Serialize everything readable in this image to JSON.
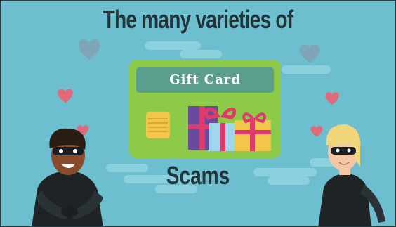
{
  "title": "The many varieties of",
  "card": {
    "label": "Gift Card"
  },
  "subtitle": "Scams",
  "colors": {
    "background": "#6dbfcf",
    "card": "#8dca4a",
    "banner": "#5c9e8e",
    "text": "#23343a",
    "heart": "#e0697a",
    "heart_faded": "#7fa6b8"
  },
  "icons": [
    "heart-icon",
    "gift-box-icon",
    "card-chip-icon",
    "masked-thief-icon"
  ]
}
